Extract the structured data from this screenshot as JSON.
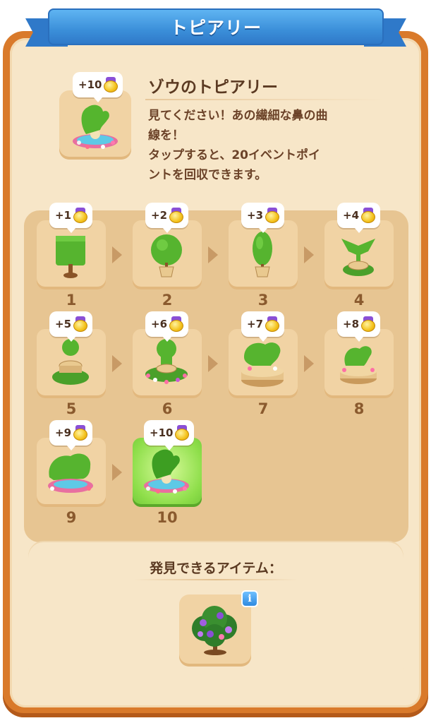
{
  "title": "トピアリー",
  "hero": {
    "reward": "+10",
    "name": "ゾウのトピアリー",
    "description_lines": [
      "見てください！あの繊細な鼻の曲",
      "線を！",
      "タップすると、20イベントポイ",
      "ントを回収できます。"
    ]
  },
  "stages": [
    {
      "num": "1",
      "reward": "+1"
    },
    {
      "num": "2",
      "reward": "+2"
    },
    {
      "num": "3",
      "reward": "+3"
    },
    {
      "num": "4",
      "reward": "+4"
    },
    {
      "num": "5",
      "reward": "+5"
    },
    {
      "num": "6",
      "reward": "+6"
    },
    {
      "num": "7",
      "reward": "+7"
    },
    {
      "num": "8",
      "reward": "+8"
    },
    {
      "num": "9",
      "reward": "+9"
    },
    {
      "num": "10",
      "reward": "+10"
    }
  ],
  "current_stage": "10",
  "find": {
    "title": "発見できるアイテム：",
    "info_glyph": "i"
  },
  "colors": {
    "frame": "#d97a2b",
    "parchment": "#f7e6c8",
    "ribbon": "#3b8fd9",
    "active_stage": "#8ede4a",
    "text": "#5b3a22",
    "medal_ribbon": "#8a4fd6",
    "medal_coin": "#f4c21b"
  },
  "icons": {
    "reward": "event-medal-icon",
    "arrow": "chevron-right-icon",
    "info": "info-icon"
  }
}
